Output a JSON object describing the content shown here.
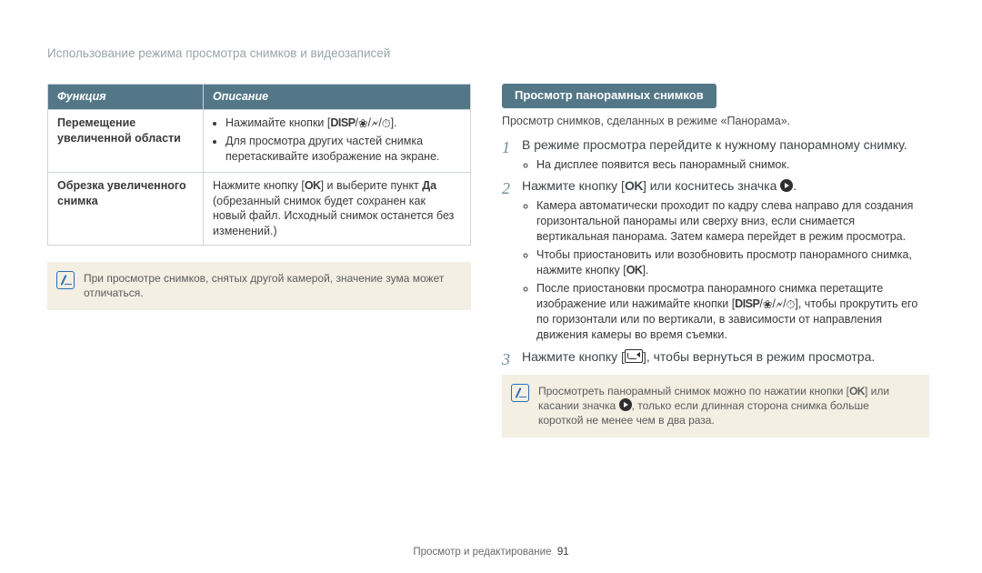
{
  "breadcrumb": "Использование режима просмотра снимков и видеозаписей",
  "table": {
    "header_function": "Функция",
    "header_description": "Описание",
    "row1_label": "Перемещение увеличенной области",
    "row1_bullet1_prefix": "Нажимайте кнопки [",
    "row1_bullet1_suffix": "].",
    "row1_bullet2": "Для просмотра других частей снимка перетаскивайте изображение на экране.",
    "row2_label": "Обрезка увеличенного снимка",
    "row2_text_a": "Нажмите кнопку [",
    "row2_text_b": "] и выберите пункт ",
    "row2_text_bold": "Да",
    "row2_text_c": " (обрезанный снимок будет сохранен как новый файл. Исходный снимок останется без изменений.)"
  },
  "note_left": "При просмотре снимков, снятых другой камерой, значение зума может отличаться.",
  "icons": {
    "disp": "DISP",
    "ok": "OK",
    "macro": "❀",
    "flash": "🗲",
    "timer": "⏱"
  },
  "right": {
    "heading": "Просмотр панорамных снимков",
    "intro": "Просмотр снимков, сделанных в режиме «Панорама».",
    "step1": "В режиме просмотра перейдите к нужному панорамному снимку.",
    "step1_bullet1": "На дисплее появится весь панорамный снимок.",
    "step2_a": "Нажмите кнопку [",
    "step2_b": "] или коснитесь значка ",
    "step2_c": ".",
    "step2_bullet1": "Камера автоматически проходит по кадру слева направо для создания горизонтальной панорамы или сверху вниз, если снимается вертикальная панорама. Затем камера перейдет в режим просмотра.",
    "step2_bullet2_a": "Чтобы приостановить или возобновить просмотр панорамного снимка, нажмите кнопку [",
    "step2_bullet2_b": "].",
    "step2_bullet3_a": "После приостановки просмотра панорамного снимка перетащите изображение или нажимайте кнопки [",
    "step2_bullet3_b": "], чтобы прокрутить его по горизонтали или по вертикали, в зависимости от направления движения камеры во время съемки.",
    "step3_a": "Нажмите кнопку [",
    "step3_b": "], чтобы вернуться в режим просмотра.",
    "note_a": "Просмотреть панорамный снимок можно по нажатии кнопки [",
    "note_b": "] или касании значка ",
    "note_c": ", только если длинная сторона снимка больше короткой не менее чем в два раза."
  },
  "footer": {
    "section": "Просмотр и редактирование",
    "page": "91"
  }
}
